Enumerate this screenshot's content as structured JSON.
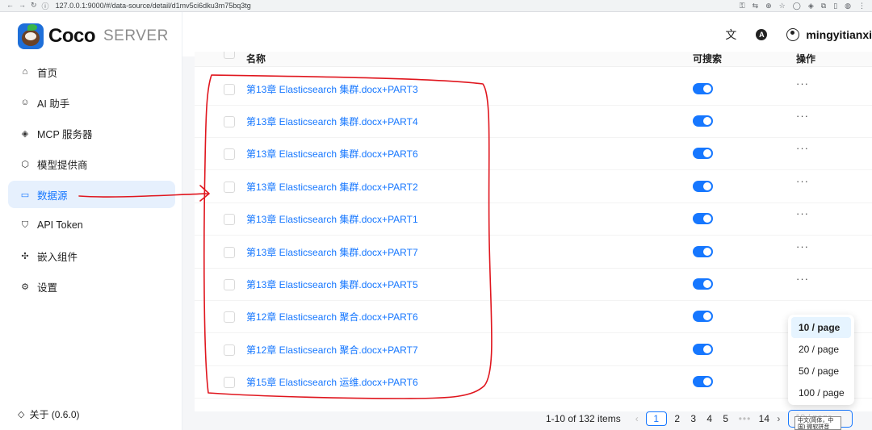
{
  "browser": {
    "url": "127.0.0.1:9000/#/data-source/detail/d1mv5ci6dku3m75bq3tg"
  },
  "logo": {
    "name": "Coco",
    "subtitle": "SERVER"
  },
  "sidebar": {
    "items": [
      {
        "label": "首页",
        "icon": "home-icon"
      },
      {
        "label": "AI 助手",
        "icon": "robot-icon"
      },
      {
        "label": "MCP 服务器",
        "icon": "mcp-icon"
      },
      {
        "label": "模型提供商",
        "icon": "cube-icon"
      },
      {
        "label": "数据源",
        "icon": "folder-icon",
        "active": true
      },
      {
        "label": "API Token",
        "icon": "shield-icon"
      },
      {
        "label": "嵌入组件",
        "icon": "puzzle-icon"
      },
      {
        "label": "设置",
        "icon": "gear-icon"
      }
    ],
    "about": "关于 (0.6.0)"
  },
  "header": {
    "username": "mingyitianxi"
  },
  "table": {
    "columns": {
      "name": "名称",
      "searchable": "可搜索",
      "actions": "操作"
    },
    "rows": [
      {
        "name": "第13章 Elasticsearch 集群.docx+PART3",
        "searchable": true,
        "actions": "···"
      },
      {
        "name": "第13章 Elasticsearch 集群.docx+PART4",
        "searchable": true,
        "actions": "···"
      },
      {
        "name": "第13章 Elasticsearch 集群.docx+PART6",
        "searchable": true,
        "actions": "···"
      },
      {
        "name": "第13章 Elasticsearch 集群.docx+PART2",
        "searchable": true,
        "actions": "···"
      },
      {
        "name": "第13章 Elasticsearch 集群.docx+PART1",
        "searchable": true,
        "actions": "···"
      },
      {
        "name": "第13章 Elasticsearch 集群.docx+PART7",
        "searchable": true,
        "actions": "···"
      },
      {
        "name": "第13章 Elasticsearch 集群.docx+PART5",
        "searchable": true,
        "actions": "···"
      },
      {
        "name": "第12章 Elasticsearch 聚合.docx+PART6",
        "searchable": true,
        "actions": ""
      },
      {
        "name": "第12章 Elasticsearch 聚合.docx+PART7",
        "searchable": true,
        "actions": ""
      },
      {
        "name": "第15章 Elasticsearch 运维.docx+PART6",
        "searchable": true,
        "actions": ""
      }
    ]
  },
  "pagination": {
    "total": "1-10 of 132 items",
    "pages": [
      "1",
      "2",
      "3",
      "4",
      "5"
    ],
    "current": "1",
    "last": "14",
    "page_size": "10 / page",
    "page_size_options": [
      "10 / page",
      "20 / page",
      "50 / page",
      "100 / page"
    ]
  },
  "tooltip": "中文(简体，中国) 微软拼音"
}
